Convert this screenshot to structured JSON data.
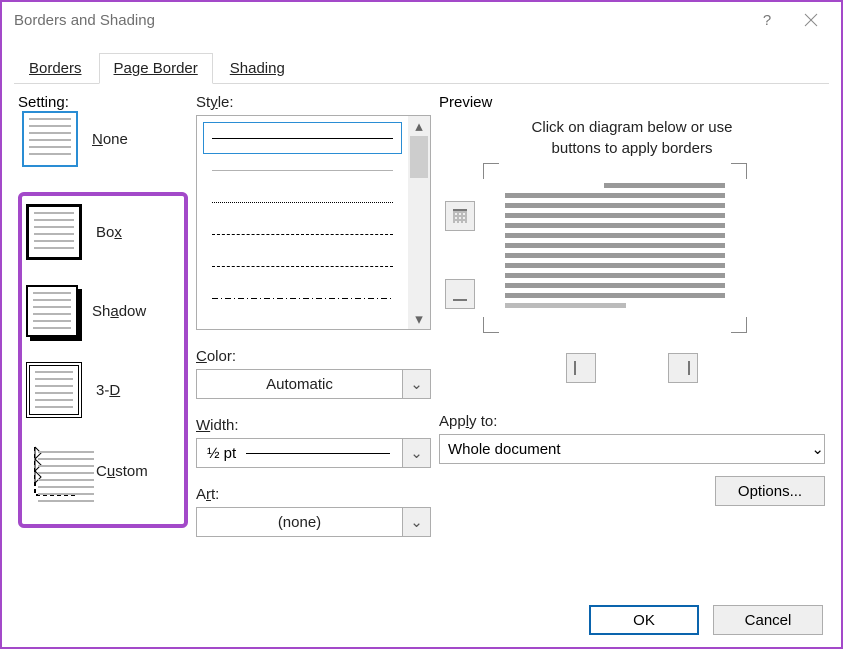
{
  "title": "Borders and Shading",
  "tabs": {
    "borders": "Borders",
    "page_border": "Page Border",
    "shading": "Shading"
  },
  "setting": {
    "legend": "Setting:",
    "none": "None",
    "box": "Box",
    "shadow": "Shadow",
    "threed": "3-D",
    "custom": "Custom"
  },
  "style": {
    "style_label": "Style:",
    "color_label": "Color:",
    "color_value": "Automatic",
    "width_label": "Width:",
    "width_value": "½ pt",
    "art_label": "Art:",
    "art_value": "(none)"
  },
  "preview": {
    "legend": "Preview",
    "hint1": "Click on diagram below or use",
    "hint2": "buttons to apply borders",
    "apply_label": "Apply to:",
    "apply_value": "Whole document",
    "options": "Options..."
  },
  "footer": {
    "ok": "OK",
    "cancel": "Cancel"
  }
}
